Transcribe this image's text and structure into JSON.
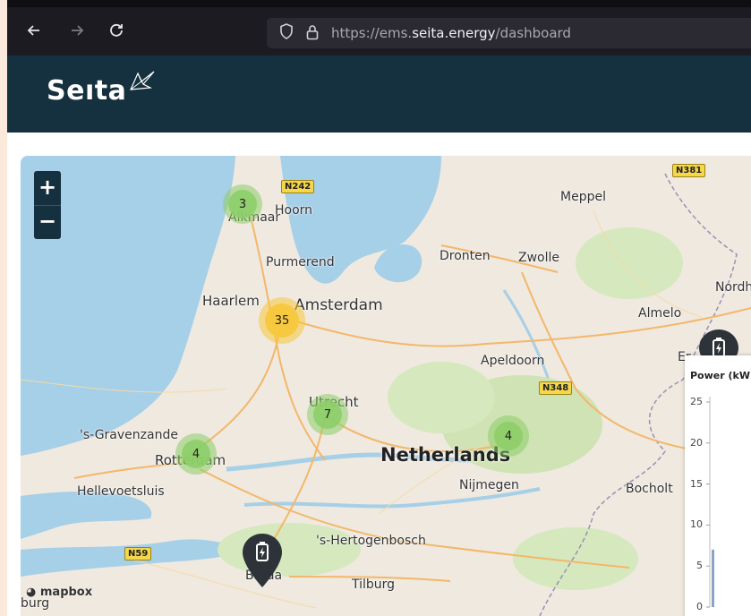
{
  "browser": {
    "back_icon": "arrow-left-icon",
    "forward_icon": "arrow-right-icon",
    "reload_icon": "reload-icon",
    "url_prefix": "https://ems.",
    "url_host": "seita.energy",
    "url_path": "/dashboard"
  },
  "header": {
    "brand": "Seıta"
  },
  "map": {
    "zoom_in": "+",
    "zoom_out": "−",
    "attribution": "mapbox",
    "cities": {
      "alkmaar": "Alkmaar",
      "hoorn": "Hoorn",
      "meppel": "Meppel",
      "purmerend": "Purmerend",
      "dronten": "Dronten",
      "zwolle": "Zwolle",
      "haarlem": "Haarlem",
      "amsterdam": "Amsterdam",
      "nordhorn": "Nordhc",
      "almelo": "Almelo",
      "apeldoorn": "Apeldoorn",
      "er": "Er",
      "utrecht": "Utrecht",
      "gravenzande": "'s-Gravenzande",
      "rotterdam": "Rotterdam",
      "netherlands": "Netherlands",
      "hellevoetsluis": "Hellevoetsluis",
      "nijmegen": "Nijmegen",
      "bocholt": "Bocholt",
      "hertogenbosch": "'s-Hertogenbosch",
      "breda": "Breda",
      "tilburg": "Tilburg",
      "burg": "burg"
    },
    "roads": {
      "n242": "N242",
      "n381": "N381",
      "n348": "N348",
      "n59": "N59"
    },
    "clusters": {
      "alkmaar": "3",
      "amsterdam": "35",
      "utrecht": "7",
      "rotterdam": "4",
      "arnhem": "4"
    }
  },
  "chart_data": {
    "type": "bar",
    "title": "Power (kW",
    "ylim": [
      0,
      25
    ],
    "yticks": [
      "25",
      "20",
      "15",
      "10",
      "5",
      "0"
    ],
    "values": [
      7
    ]
  }
}
